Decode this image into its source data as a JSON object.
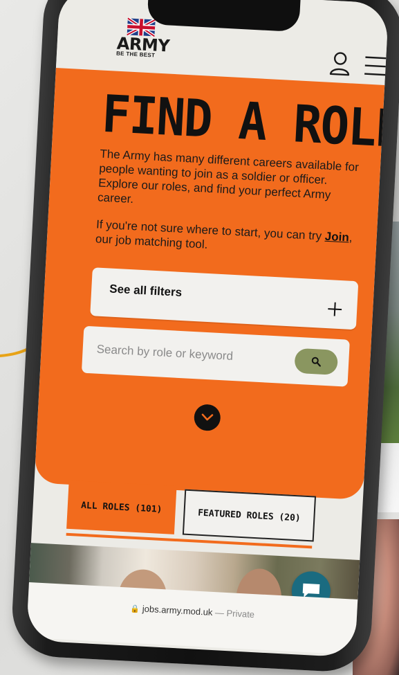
{
  "logo": {
    "word": "ARMY",
    "tagline": "BE THE BEST"
  },
  "header": {
    "account_icon": "account-icon",
    "menu_icon": "hamburger-menu-icon"
  },
  "hero": {
    "title": "FIND A ROLE",
    "paragraph1": "The Army has many different careers available for people wanting to join as a soldier or officer. Explore our roles, and find your perfect Army career.",
    "paragraph2_before": "If you're not sure where to start, you can try ",
    "paragraph2_link": "Join",
    "paragraph2_after": ", our job matching tool."
  },
  "filters": {
    "label": "See all filters",
    "icon": "plus-icon"
  },
  "search": {
    "placeholder": "Search by role or keyword",
    "value": "",
    "button_icon": "search-icon"
  },
  "tabs": {
    "all_roles": "ALL ROLES (101)",
    "featured_roles": "FEATURED ROLES (20)",
    "active": "all_roles"
  },
  "browser": {
    "domain": "jobs.army.mod.uk",
    "mode": "— Private"
  },
  "colors": {
    "accent": "#f26b1d",
    "search_button": "#8a9660",
    "chat": "#1a6b80"
  }
}
